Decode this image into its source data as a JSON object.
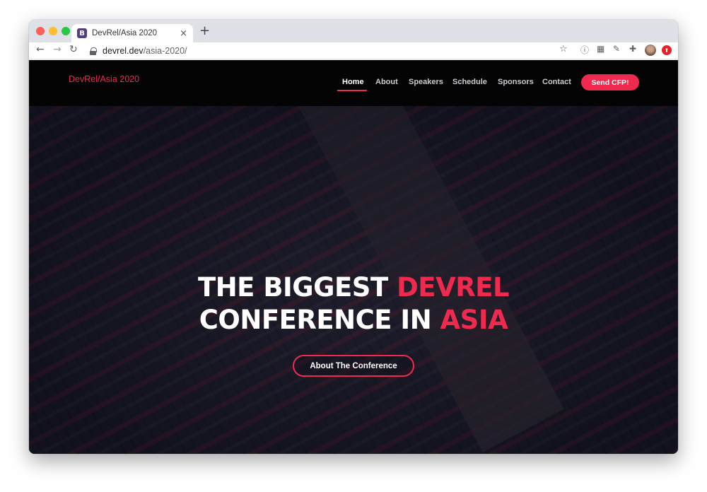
{
  "browser": {
    "tab_title": "DevRel/Asia 2020",
    "favicon_letter": "B",
    "tab_close": "×",
    "new_tab": "+",
    "url_host": "devrel.dev",
    "url_path": "/asia-2020/",
    "icons": [
      "back-icon",
      "forward-icon",
      "reload-icon",
      "lock-icon",
      "star-icon",
      "info-icon",
      "qr-code-icon",
      "eyedropper-icon",
      "extensions-icon",
      "profile-avatar-icon",
      "ext-red-icon"
    ]
  },
  "site": {
    "brand": "DevRel/Asia 2020",
    "nav": [
      {
        "label": "Home",
        "active": true
      },
      {
        "label": "About"
      },
      {
        "label": "Speakers"
      },
      {
        "label": "Schedule"
      },
      {
        "label": "Sponsors"
      },
      {
        "label": "Contact"
      }
    ],
    "cfp_button": "Send CFP!",
    "headline": {
      "line1_white": "THE BIGGEST ",
      "line1_accent": "DEVREL",
      "line2_white": "CONFERENCE IN ",
      "line2_accent": "ASIA"
    },
    "cta_button": "About The Conference"
  },
  "colors": {
    "accent": "#f0294f",
    "navbar_bg": "#040405",
    "text_white": "#ffffff"
  }
}
